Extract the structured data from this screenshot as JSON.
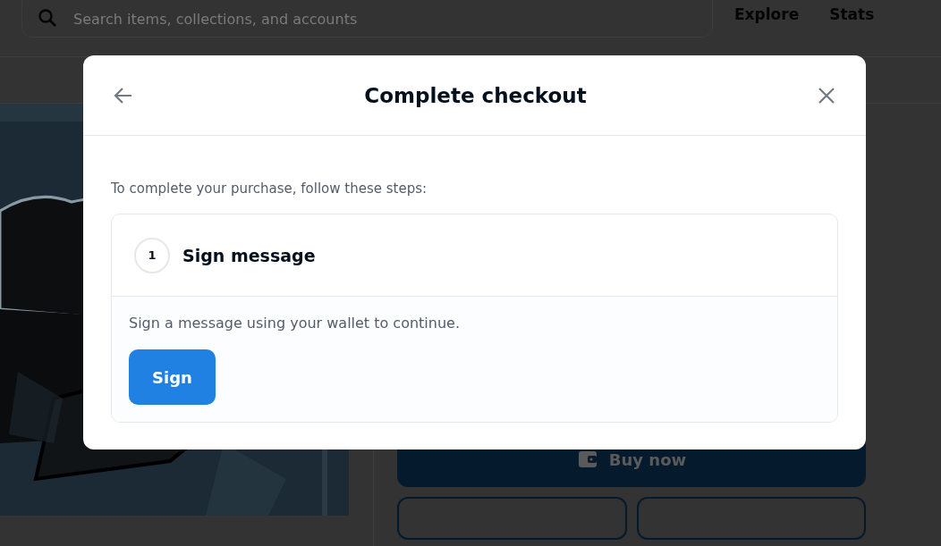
{
  "header": {
    "search": {
      "placeholder": "Search items, collections, and accounts"
    },
    "nav": [
      "Explore",
      "Stats"
    ]
  },
  "item": {
    "buy_button": "Buy now"
  },
  "modal": {
    "title": "Complete checkout",
    "intro": "To complete your purchase, follow these steps:",
    "steps": [
      {
        "number": "1",
        "title": "Sign message",
        "expanded": true,
        "description": "Sign a message using your wallet to continue.",
        "button": "Sign"
      }
    ]
  }
}
